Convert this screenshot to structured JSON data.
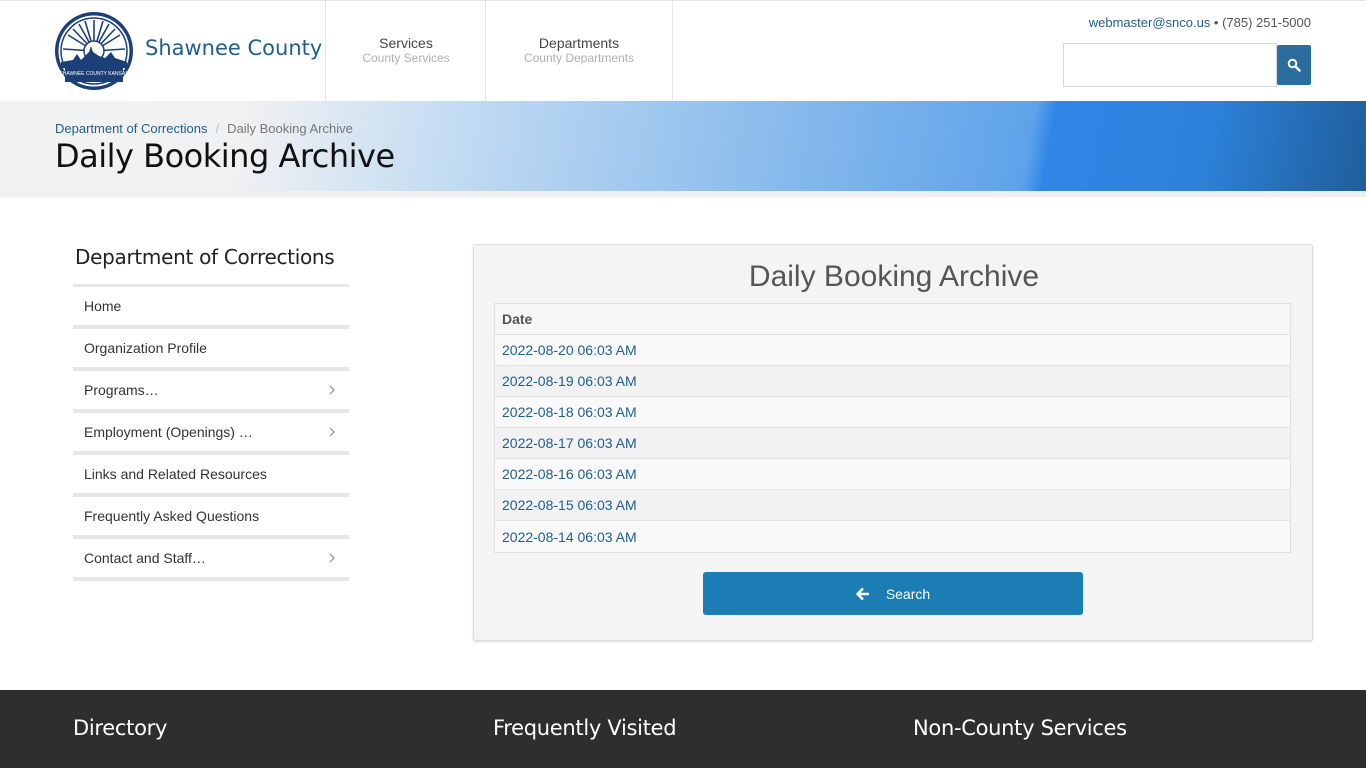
{
  "header": {
    "site_name": "Shawnee County",
    "logo_text": "SHAWNEE COUNTY KANSAS",
    "nav": [
      {
        "title": "Services",
        "subtitle": "County Services"
      },
      {
        "title": "Departments",
        "subtitle": "County Departments"
      }
    ],
    "contact_email": "webmaster@snco.us",
    "contact_separator": " • ",
    "contact_phone": "(785) 251-5000",
    "search_placeholder": "",
    "search_icon": "search-icon"
  },
  "banner": {
    "breadcrumb": [
      {
        "label": "Department of Corrections"
      },
      {
        "label": "Daily Booking Archive"
      }
    ],
    "title": "Daily Booking Archive"
  },
  "sidebar": {
    "title": "Department of Corrections",
    "items": [
      {
        "label": "Home",
        "has_submenu": false
      },
      {
        "label": "Organization Profile",
        "has_submenu": false
      },
      {
        "label": "Programs…",
        "has_submenu": true
      },
      {
        "label": "Employment (Openings) …",
        "has_submenu": true
      },
      {
        "label": "Links and Related Resources",
        "has_submenu": false
      },
      {
        "label": "Frequently Asked Questions",
        "has_submenu": false
      },
      {
        "label": "Contact and Staff…",
        "has_submenu": true
      }
    ]
  },
  "main": {
    "title": "Daily Booking Archive",
    "table": {
      "header": "Date",
      "rows": [
        "2022-08-20 06:03 AM",
        "2022-08-19 06:03 AM",
        "2022-08-18 06:03 AM",
        "2022-08-17 06:03 AM",
        "2022-08-16 06:03 AM",
        "2022-08-15 06:03 AM",
        "2022-08-14 06:03 AM"
      ]
    },
    "search_button": "Search"
  },
  "footer": {
    "columns": [
      "Directory",
      "Frequently Visited",
      "Non-County Services"
    ]
  },
  "colors": {
    "brand": "#1f5f8b",
    "button": "#1c7cb4",
    "footer_bg": "#2e2e2e"
  }
}
